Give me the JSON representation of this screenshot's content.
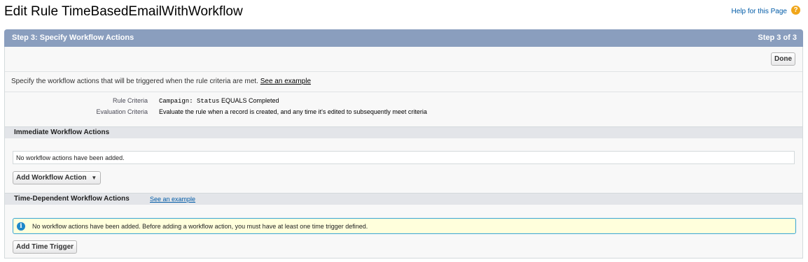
{
  "header": {
    "title": "Edit Rule TimeBasedEmailWithWorkflow",
    "help_link": "Help for this Page",
    "help_icon": "question-icon"
  },
  "step": {
    "title": "Step 3: Specify Workflow Actions",
    "count": "Step 3 of 3",
    "done_button": "Done"
  },
  "description": {
    "text": "Specify the workflow actions that will be triggered when the rule criteria are met.",
    "link": "See an example"
  },
  "criteria": {
    "rule_label": "Rule Criteria",
    "rule_field": "Campaign: Status",
    "rule_operator": "EQUALS",
    "rule_value": "Completed",
    "eval_label": "Evaluation Criteria",
    "eval_value": "Evaluate the rule when a record is created, and any time it's edited to subsequently meet criteria"
  },
  "immediate": {
    "title": "Immediate Workflow Actions",
    "empty_text": "No workflow actions have been added.",
    "add_button": "Add Workflow Action"
  },
  "time_dependent": {
    "title": "Time-Dependent Workflow Actions",
    "link": "See an example",
    "info_text": "No workflow actions have been added. Before adding a workflow action, you must have at least one time trigger defined.",
    "add_button": "Add Time Trigger"
  },
  "colors": {
    "header_bar": "#8a9ebe",
    "section_bar": "#e3e5e9",
    "info_bg": "#ffffdc",
    "info_border": "#39a5d4",
    "link": "#015ba7"
  }
}
